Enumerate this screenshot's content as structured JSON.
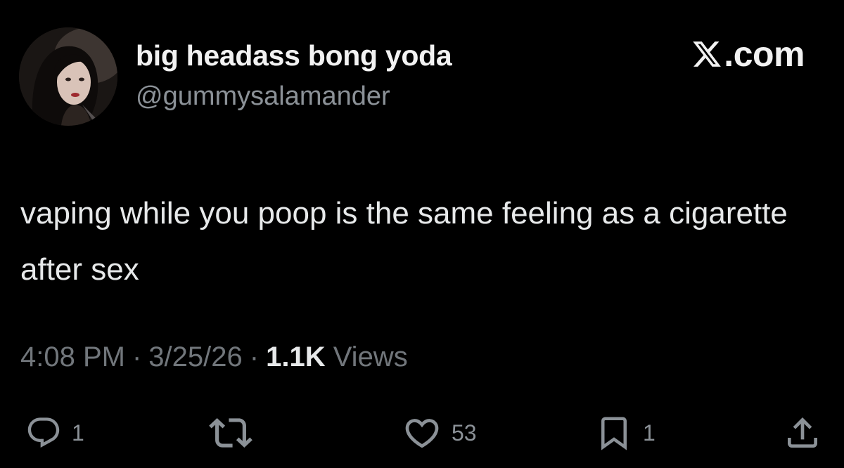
{
  "author": {
    "display_name": "big headass bong yoda",
    "handle": "@gummysalamander",
    "avatar_icon": "profile-photo"
  },
  "brand": {
    "icon": "x-logo-icon",
    "suffix": ".com"
  },
  "tweet": {
    "text": "vaping while you poop is the same feeling as a cigarette after sex"
  },
  "meta": {
    "time": "4:08 PM",
    "separator": "·",
    "date": "3/25/26",
    "views_count": "1.1K",
    "views_label": "Views"
  },
  "actions": {
    "reply": {
      "icon": "reply-icon",
      "count": "1"
    },
    "retweet": {
      "icon": "retweet-icon",
      "count": ""
    },
    "like": {
      "icon": "heart-icon",
      "count": "53"
    },
    "bookmark": {
      "icon": "bookmark-icon",
      "count": "1"
    },
    "share": {
      "icon": "share-icon",
      "count": ""
    }
  },
  "colors": {
    "background": "#000000",
    "primary_text": "#e7e9ea",
    "secondary_text": "#71767b"
  }
}
